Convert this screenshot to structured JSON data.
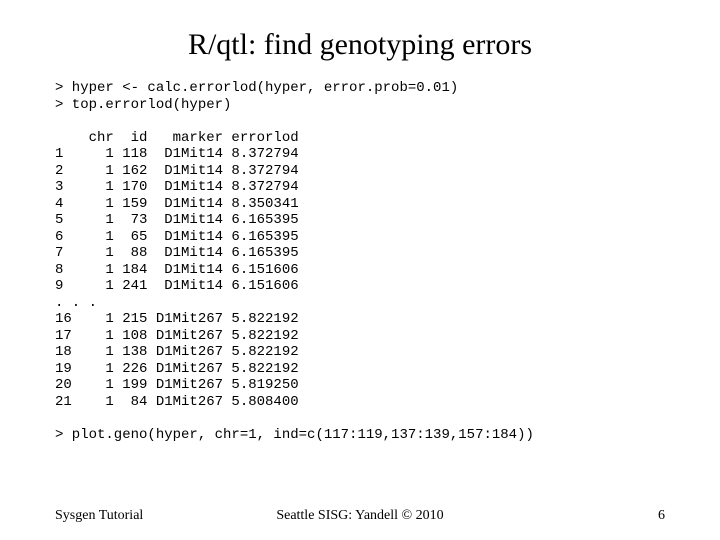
{
  "title": "R/qtl: find genotyping errors",
  "code_block": "> hyper <- calc.errorlod(hyper, error.prob=0.01)\n> top.errorlod(hyper)\n\n    chr  id   marker errorlod\n1     1 118  D1Mit14 8.372794\n2     1 162  D1Mit14 8.372794\n3     1 170  D1Mit14 8.372794\n4     1 159  D1Mit14 8.350341\n5     1  73  D1Mit14 6.165395\n6     1  65  D1Mit14 6.165395\n7     1  88  D1Mit14 6.165395\n8     1 184  D1Mit14 6.151606\n9     1 241  D1Mit14 6.151606\n. . .\n16    1 215 D1Mit267 5.822192\n17    1 108 D1Mit267 5.822192\n18    1 138 D1Mit267 5.822192\n19    1 226 D1Mit267 5.822192\n20    1 199 D1Mit267 5.819250\n21    1  84 D1Mit267 5.808400\n\n> plot.geno(hyper, chr=1, ind=c(117:119,137:139,157:184))",
  "footer": {
    "left": "Sysgen Tutorial",
    "center": "Seattle SISG: Yandell © 2010",
    "right": "6"
  },
  "chart_data": {
    "type": "table",
    "title": "top.errorlod(hyper)",
    "columns": [
      "row",
      "chr",
      "id",
      "marker",
      "errorlod"
    ],
    "rows": [
      [
        1,
        1,
        118,
        "D1Mit14",
        8.372794
      ],
      [
        2,
        1,
        162,
        "D1Mit14",
        8.372794
      ],
      [
        3,
        1,
        170,
        "D1Mit14",
        8.372794
      ],
      [
        4,
        1,
        159,
        "D1Mit14",
        8.350341
      ],
      [
        5,
        1,
        73,
        "D1Mit14",
        6.165395
      ],
      [
        6,
        1,
        65,
        "D1Mit14",
        6.165395
      ],
      [
        7,
        1,
        88,
        "D1Mit14",
        6.165395
      ],
      [
        8,
        1,
        184,
        "D1Mit14",
        6.151606
      ],
      [
        9,
        1,
        241,
        "D1Mit14",
        6.151606
      ],
      [
        16,
        1,
        215,
        "D1Mit267",
        5.822192
      ],
      [
        17,
        1,
        108,
        "D1Mit267",
        5.822192
      ],
      [
        18,
        1,
        138,
        "D1Mit267",
        5.822192
      ],
      [
        19,
        1,
        226,
        "D1Mit267",
        5.822192
      ],
      [
        20,
        1,
        199,
        "D1Mit267",
        5.81925
      ],
      [
        21,
        1,
        84,
        "D1Mit267",
        5.8084
      ]
    ],
    "commands": [
      "hyper <- calc.errorlod(hyper, error.prob=0.01)",
      "top.errorlod(hyper)",
      "plot.geno(hyper, chr=1, ind=c(117:119,137:139,157:184))"
    ]
  }
}
